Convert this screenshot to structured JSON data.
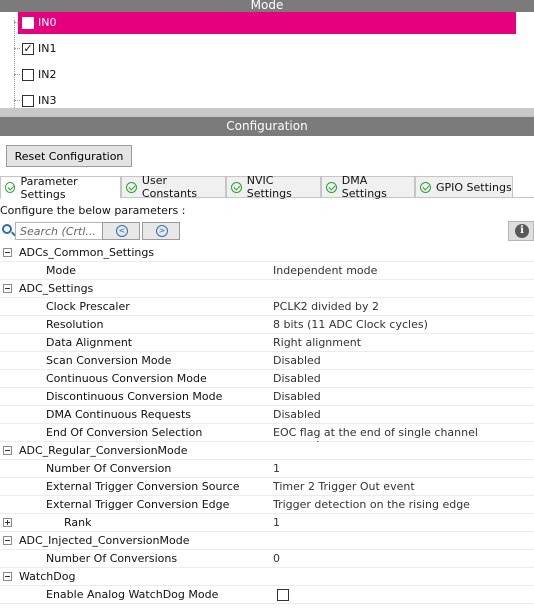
{
  "mode": {
    "header": "Mode",
    "items": [
      {
        "label": "IN0",
        "checked": false,
        "selected": true
      },
      {
        "label": "IN1",
        "checked": true,
        "selected": false
      },
      {
        "label": "IN2",
        "checked": false,
        "selected": false
      },
      {
        "label": "IN3",
        "checked": false,
        "selected": false
      }
    ],
    "checkmark": "✓"
  },
  "configuration": {
    "header": "Configuration",
    "reset_label": "Reset Configuration",
    "tabs": [
      {
        "label": "Parameter Settings",
        "active": true
      },
      {
        "label": "User Constants",
        "active": false
      },
      {
        "label": "NVIC Settings",
        "active": false
      },
      {
        "label": "DMA Settings",
        "active": false
      },
      {
        "label": "GPIO Settings",
        "active": false
      }
    ],
    "configure_label": "Configure the below parameters :",
    "search_placeholder": "Search (Crtl...",
    "prev_glyph": "<",
    "next_glyph": ">",
    "info_glyph": "i"
  },
  "parameters": [
    {
      "type": "group",
      "name": "ADCs_Common_Settings"
    },
    {
      "type": "param",
      "name": "Mode",
      "value": "Independent mode"
    },
    {
      "type": "group",
      "name": "ADC_Settings"
    },
    {
      "type": "param",
      "name": "Clock Prescaler",
      "value": "PCLK2 divided by 2"
    },
    {
      "type": "param",
      "name": "Resolution",
      "value": "8 bits (11 ADC Clock cycles)"
    },
    {
      "type": "param",
      "name": "Data Alignment",
      "value": "Right alignment"
    },
    {
      "type": "param",
      "name": "Scan Conversion Mode",
      "value": "Disabled"
    },
    {
      "type": "param",
      "name": "Continuous Conversion Mode",
      "value": "Disabled"
    },
    {
      "type": "param",
      "name": "Discontinuous Conversion Mode",
      "value": "Disabled"
    },
    {
      "type": "param",
      "name": "DMA Continuous Requests",
      "value": "Disabled"
    },
    {
      "type": "param",
      "name": "End Of Conversion Selection",
      "value": "EOC flag at the end of single channel conversion"
    },
    {
      "type": "group",
      "name": "ADC_Regular_ConversionMode"
    },
    {
      "type": "param",
      "name": "Number Of Conversion",
      "value": "1"
    },
    {
      "type": "param",
      "name": "External Trigger Conversion Source",
      "value": "Timer 2 Trigger Out event"
    },
    {
      "type": "param",
      "name": "External Trigger Conversion Edge",
      "value": "Trigger detection on the rising edge"
    },
    {
      "type": "rank",
      "name": "Rank",
      "value": "1"
    },
    {
      "type": "group",
      "name": "ADC_Injected_ConversionMode"
    },
    {
      "type": "param",
      "name": "Number Of Conversions",
      "value": "0"
    },
    {
      "type": "group",
      "name": "WatchDog"
    },
    {
      "type": "checkbox",
      "name": "Enable Analog WatchDog Mode",
      "checked": false
    }
  ],
  "colors": {
    "selected_row": "#e6007e",
    "header_bar": "#7b7b7b",
    "ok_icon": "#2ca02c",
    "nav_icon": "#2f6fb0"
  }
}
